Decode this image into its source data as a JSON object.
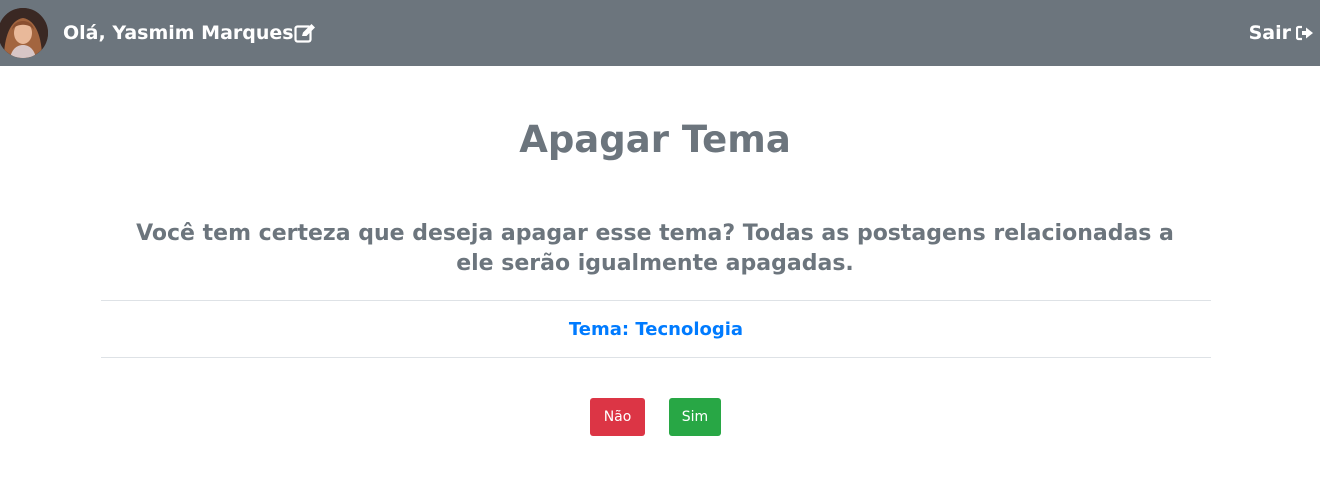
{
  "navbar": {
    "avatar_icon": "user-avatar",
    "greeting": "Olá, Yasmim Marques",
    "edit_icon": "edit-icon",
    "logout_label": "Sair",
    "logout_icon": "sign-out-icon",
    "background": "#6c757d"
  },
  "main": {
    "title": "Apagar Tema",
    "warning": "Você tem certeza que deseja apagar esse tema? Todas as postagens relacionadas a ele serão igualmente apagadas.",
    "theme_text": "Tema: Tecnologia",
    "theme_color": "#007bff",
    "no_label": "Não",
    "yes_label": "Sim",
    "no_color": "#dc3545",
    "yes_color": "#28a745"
  }
}
